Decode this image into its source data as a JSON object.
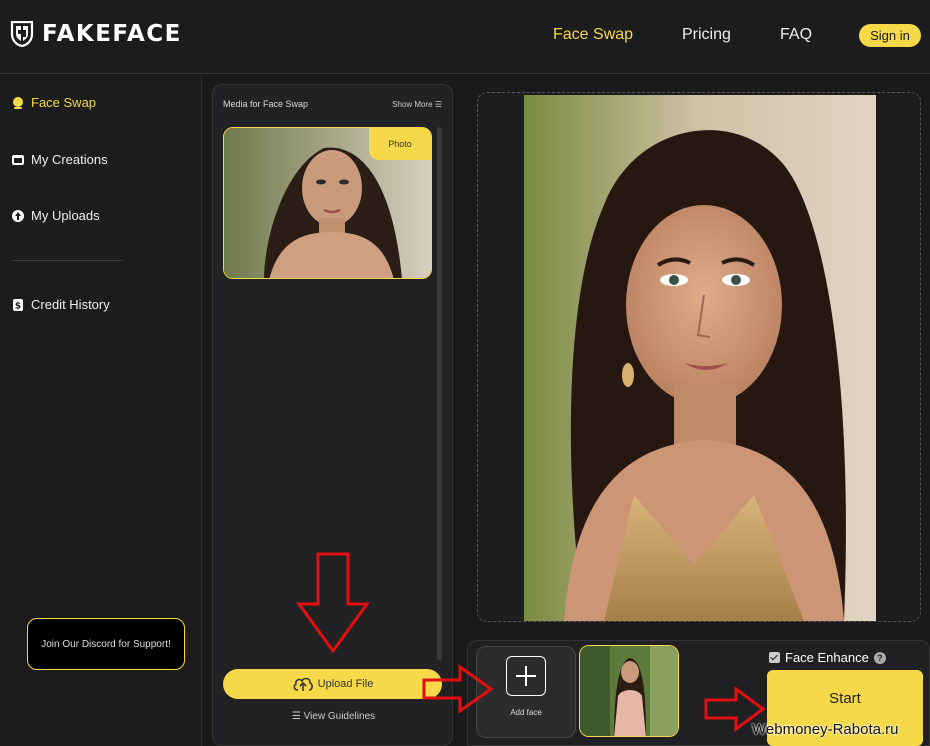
{
  "header": {
    "brand": "FAKEFACE",
    "nav": [
      "Face Swap",
      "Pricing",
      "FAQ"
    ],
    "signin_label": "Sign in"
  },
  "sidebar": {
    "items": [
      {
        "label": "Face Swap",
        "icon": "face-icon",
        "active": true
      },
      {
        "label": "My Creations",
        "icon": "folder-icon"
      },
      {
        "label": "My Uploads",
        "icon": "cloud-upload-icon"
      },
      {
        "label": "Credit History",
        "icon": "dollar-icon"
      }
    ],
    "discord_label": "Join Our Discord for Support!"
  },
  "media_panel": {
    "title": "Media for Face Swap",
    "show_more": "Show More ☰",
    "photo_tag": "Photo",
    "upload_label": "Upload File",
    "guidelines_label": "☰ View Guidelines"
  },
  "bottom": {
    "add_face_label": "Add face",
    "face_enhance_label": "Face Enhance",
    "help_glyph": "?",
    "start_label": "Start"
  },
  "watermark": "Webmoney-Rabota.ru",
  "colors": {
    "accent": "#f5d949",
    "background": "#1a1a1b",
    "arrow": "#e01010"
  }
}
